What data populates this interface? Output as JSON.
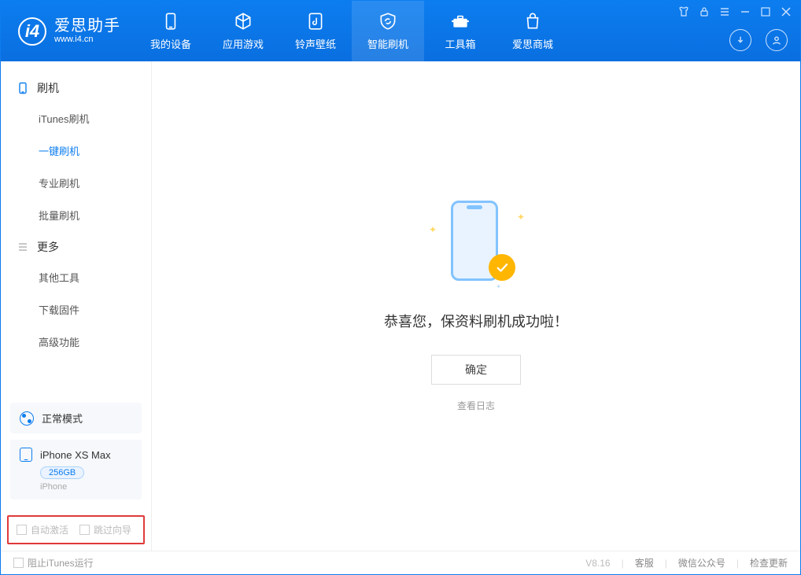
{
  "app": {
    "name_cn": "爱思助手",
    "name_en": "www.i4.cn"
  },
  "tabs": [
    {
      "label": "我的设备"
    },
    {
      "label": "应用游戏"
    },
    {
      "label": "铃声壁纸"
    },
    {
      "label": "智能刷机"
    },
    {
      "label": "工具箱"
    },
    {
      "label": "爱思商城"
    }
  ],
  "sidebar": {
    "section1": {
      "title": "刷机"
    },
    "items1": [
      {
        "label": "iTunes刷机"
      },
      {
        "label": "一键刷机"
      },
      {
        "label": "专业刷机"
      },
      {
        "label": "批量刷机"
      }
    ],
    "section2": {
      "title": "更多"
    },
    "items2": [
      {
        "label": "其他工具"
      },
      {
        "label": "下载固件"
      },
      {
        "label": "高级功能"
      }
    ]
  },
  "mode": {
    "label": "正常模式"
  },
  "device": {
    "name": "iPhone XS Max",
    "capacity": "256GB",
    "type": "iPhone"
  },
  "options": {
    "auto_activate": "自动激活",
    "skip_guide": "跳过向导"
  },
  "main": {
    "success_text": "恭喜您，保资料刷机成功啦！",
    "ok_label": "确定",
    "log_link": "查看日志"
  },
  "footer": {
    "block_itunes": "阻止iTunes运行",
    "version": "V8.16",
    "links": [
      "客服",
      "微信公众号",
      "检查更新"
    ]
  }
}
